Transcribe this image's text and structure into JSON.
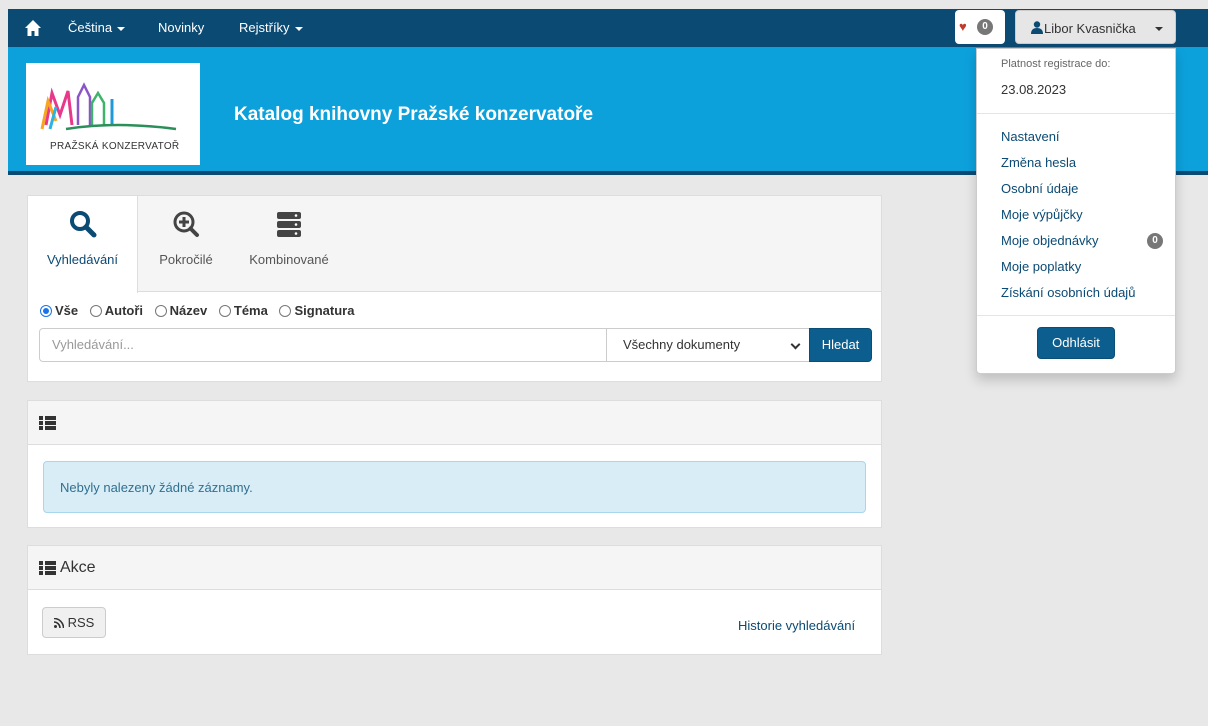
{
  "topnav": {
    "home_icon": "home-icon",
    "language_label": "Čeština",
    "news_label": "Novinky",
    "registers_label": "Rejstříky",
    "favorites_count": "0",
    "user_name": "Libor Kvasnička"
  },
  "banner": {
    "logo_text": "PRAŽSKÁ KONZERVATOŘ",
    "title": "Katalog knihovny Pražské konzervatoře"
  },
  "search": {
    "tabs": [
      {
        "label": "Vyhledávání",
        "icon": "search-icon"
      },
      {
        "label": "Pokročilé",
        "icon": "zoom-in-icon"
      },
      {
        "label": "Kombinované",
        "icon": "server-icon"
      }
    ],
    "radios": [
      "Vše",
      "Autoři",
      "Název",
      "Téma",
      "Signatura"
    ],
    "selected_radio": "Vše",
    "input_placeholder": "Vyhledávání...",
    "select_value": "Všechny dokumenty",
    "button_label": "Hledat"
  },
  "results": {
    "message": "Nebyly nalezeny žádné záznamy."
  },
  "actions": {
    "title": "Akce",
    "rss_label": "RSS",
    "history_label": "Historie vyhledávání"
  },
  "user_menu": {
    "registration_label": "Platnost registrace do:",
    "registration_date": "23.08.2023",
    "items": [
      "Nastavení",
      "Změna hesla",
      "Osobní údaje",
      "Moje výpůjčky",
      "Moje objednávky",
      "Moje poplatky",
      "Získání osobních údajů"
    ],
    "orders_count": "0",
    "logout_label": "Odhlásit"
  },
  "colors": {
    "navbar": "#0b4a73",
    "banner": "#0da1dc",
    "primary_button": "#0b5e8e",
    "alert_bg": "#d9edf7"
  }
}
